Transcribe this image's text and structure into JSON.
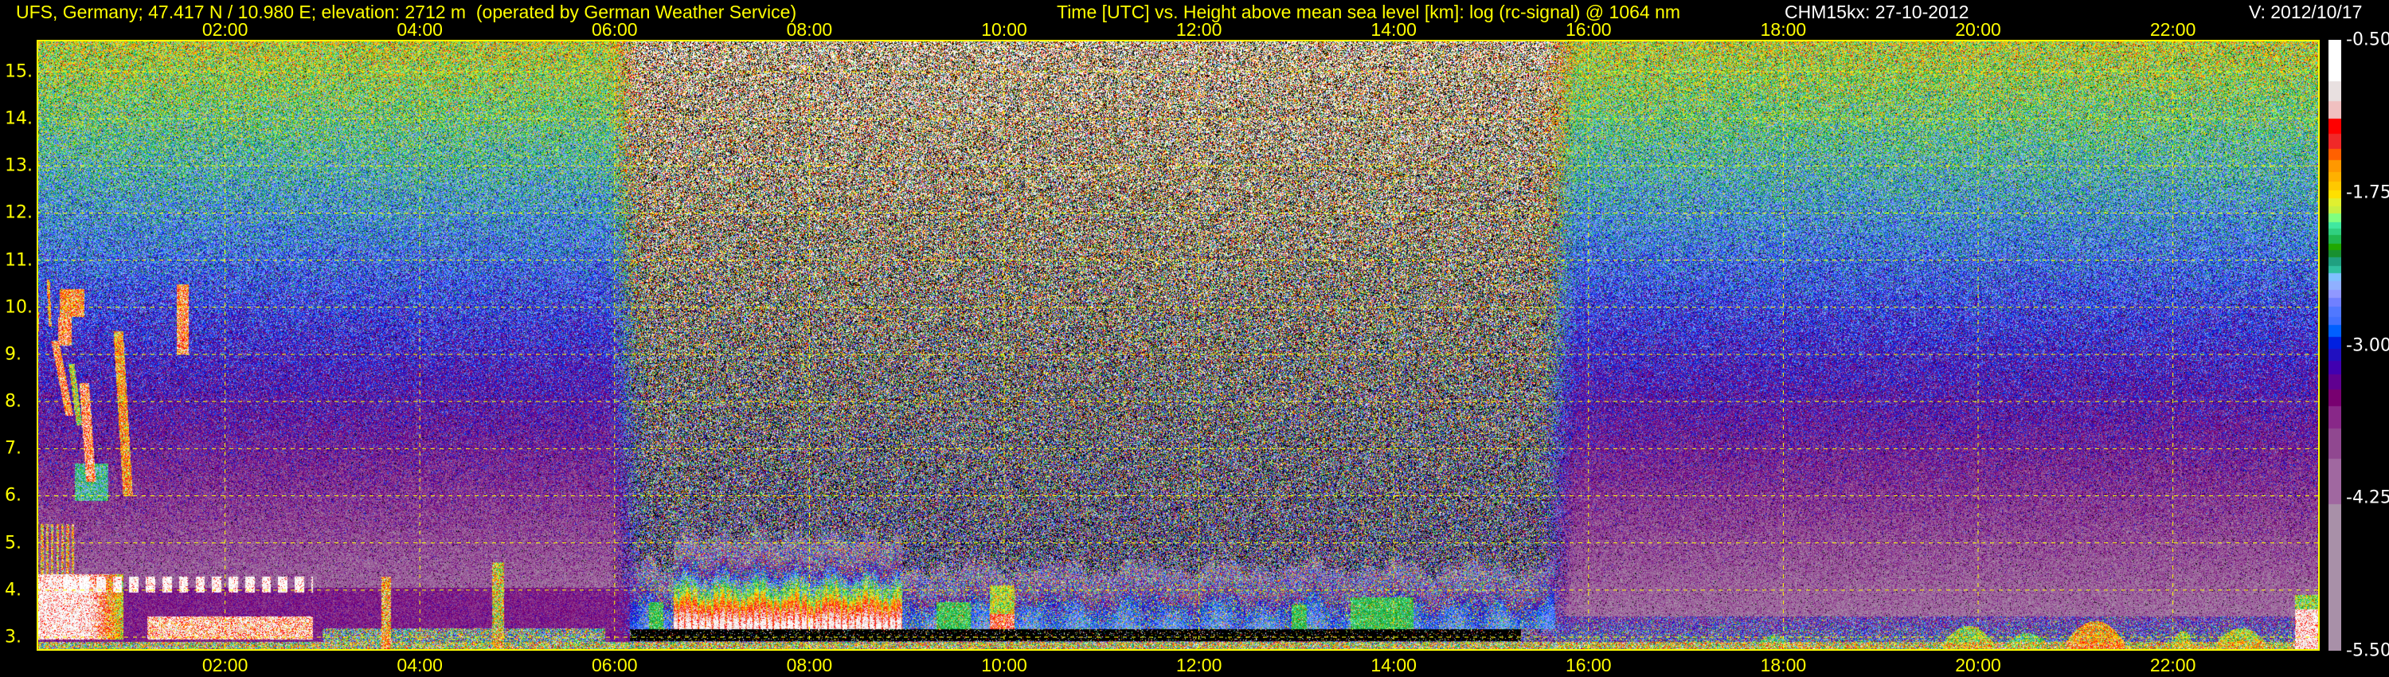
{
  "header": {
    "title_left": "UFS, Germany; 47.417 N / 10.980 E; elevation: 2712 m  (operated by German Weather Service)",
    "title_center": "Time [UTC] vs. Height above mean sea level [km]: log (rc-signal) @ 1064 nm",
    "instrument_date": "CHM15kx: 27-10-2012",
    "version": "V: 2012/10/17"
  },
  "colors": {
    "text": "#ffff00",
    "grid": "#ffff00",
    "background": "#000000"
  },
  "chart_data": {
    "type": "heatmap",
    "title": "Time [UTC] vs. Height above mean sea level [km]: log (rc-signal) @ 1064 nm",
    "xlabel": "Time [UTC]",
    "ylabel": "Height above mean sea level [km]",
    "xlim": [
      0.07,
      23.5
    ],
    "ylim": [
      2.71,
      15.68
    ],
    "x_ticks": [
      2,
      4,
      6,
      8,
      10,
      12,
      14,
      16,
      18,
      20,
      22
    ],
    "x_tick_labels": [
      "02:00",
      "04:00",
      "06:00",
      "08:00",
      "10:00",
      "12:00",
      "14:00",
      "16:00",
      "18:00",
      "20:00",
      "22:00"
    ],
    "y_ticks": [
      3,
      4,
      5,
      6,
      7,
      8,
      9,
      10,
      11,
      12,
      13,
      14,
      15
    ],
    "y_tick_labels": [
      "3.",
      "4.",
      "5.",
      "6.",
      "7.",
      "8.",
      "9.",
      "10.",
      "11.",
      "12.",
      "13.",
      "14.",
      "15."
    ],
    "grid": true,
    "colorbar": {
      "range": [
        -5.5,
        -0.5
      ],
      "ticks": [
        -0.5,
        -1.75,
        -3.0,
        -4.25,
        -5.5
      ],
      "tick_labels": [
        "-0.50",
        "-1.75",
        "-3.00",
        "-4.25",
        "-5.50"
      ],
      "segments": [
        {
          "color": "#ffffff",
          "min": -0.84
        },
        {
          "color": "#e8e0e0",
          "min": -1.0
        },
        {
          "color": "#f0c0c0",
          "min": -1.145
        },
        {
          "color": "#ff0000",
          "min": -1.268
        },
        {
          "color": "#f02828",
          "min": -1.39
        },
        {
          "color": "#ff6000",
          "min": -1.485
        },
        {
          "color": "#ff9800",
          "min": -1.587
        },
        {
          "color": "#ffb000",
          "min": -1.662
        },
        {
          "color": "#ffc800",
          "min": -1.736
        },
        {
          "color": "#ffe000",
          "min": -1.8
        },
        {
          "color": "#e0f030",
          "min": -1.866
        },
        {
          "color": "#c8f040",
          "min": -1.92
        },
        {
          "color": "#80ff80",
          "min": -1.99
        },
        {
          "color": "#40e8a0",
          "min": -2.045
        },
        {
          "color": "#30d080",
          "min": -2.1
        },
        {
          "color": "#20b850",
          "min": -2.17
        },
        {
          "color": "#20a800",
          "min": -2.22
        },
        {
          "color": "#189030",
          "min": -2.28
        },
        {
          "color": "#20a080",
          "min": -2.35
        },
        {
          "color": "#30c0a0",
          "min": -2.41
        },
        {
          "color": "#80c0ff",
          "min": -2.477
        },
        {
          "color": "#90b0ff",
          "min": -2.545
        },
        {
          "color": "#9098ff",
          "min": -2.613
        },
        {
          "color": "#7080ff",
          "min": -2.687
        },
        {
          "color": "#5078ff",
          "min": -2.77
        },
        {
          "color": "#4070ff",
          "min": -2.837
        },
        {
          "color": "#0060ff",
          "min": -2.93
        },
        {
          "color": "#0020e0",
          "min": -3.03
        },
        {
          "color": "#2010c0",
          "min": -3.13
        },
        {
          "color": "#4000b0",
          "min": -3.234
        },
        {
          "color": "#600090",
          "min": -3.36
        },
        {
          "color": "#780070",
          "min": -3.5
        },
        {
          "color": "#882888",
          "min": -3.68
        },
        {
          "color": "#904890",
          "min": -3.93
        },
        {
          "color": "#a068a0",
          "min": -4.3
        },
        {
          "color": "#a890a8",
          "min": -5.5
        }
      ]
    }
  }
}
